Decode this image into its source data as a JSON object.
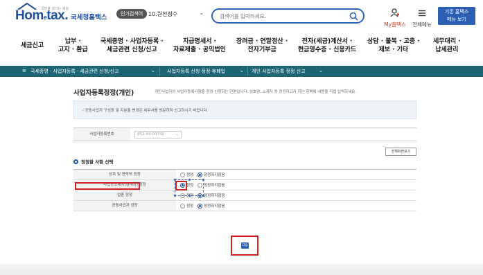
{
  "header": {
    "logo_text": "Hom",
    "logo_e": "e",
    "logo_text2": "tax.",
    "logo_tagline": "국민을 섬기는 세상",
    "logo_subtitle": "국세청홈택스",
    "popular_badge": "인기검색어",
    "popular_word": "10.원천징수",
    "search_placeholder": "검색어를 입력하세요.",
    "my_hometax": "My홈택스",
    "all_menu": "전체메뉴",
    "legacy_btn_line1": "기존 홈택스",
    "legacy_btn_line2": "메뉴 보기"
  },
  "gnb": [
    {
      "line1": "세금신고",
      "line2": ""
    },
    {
      "line1": "납부 ·",
      "line2": "고지 · 환급"
    },
    {
      "line1": "국세증명 · 사업자등록 ·",
      "line2": "세금관련 신청/신고"
    },
    {
      "line1": "지급명세서 ·",
      "line2": "자료제출 · 공익법인"
    },
    {
      "line1": "장려금 · 연말정산 ·",
      "line2": "전자기부금"
    },
    {
      "line1": "전자(세금)계산서 ·",
      "line2": "현금영수증 · 신용카드"
    },
    {
      "line1": "상담 · 불복 · 고충 ·",
      "line2": "제보 · 기타"
    },
    {
      "line1": "세무대리 ·",
      "line2": "납세관리"
    }
  ],
  "breadcrumb": {
    "menu_icon": "≡",
    "item1": "국세증명 · 사업자등록 · 세금관련 신청/신고",
    "item2": "사업자등록 신청·정정·휴폐업",
    "item3": "개인 사업자등록 정정 신고"
  },
  "content": {
    "title": "사업자등록정정(개인)",
    "description": "개인사업자의 사업자등록사항을 정정 신청하는 민원입니다. 상호명, 소재지 등 정정하고자 하는 항목에 내용을 직접 입력하세요.",
    "notice": "- 공동사업자 구성원 및 지분율 변경은 세무서를 방문하여 신고하시기 바랍니다.",
    "reg_no_label": "사업자등록번호",
    "reg_no_value": "852-44-00740",
    "view_all_button": "전체화면보기",
    "section_title": "정정할 사항 선택",
    "options": [
      {
        "label": "상호 및 연락처 정정",
        "yes": "정정",
        "no": "정정하지않음",
        "selected": "no"
      },
      {
        "label": "사업장소재지(임대차) 정정",
        "yes": "정정",
        "no": "정정하지않음",
        "selected": "yes"
      },
      {
        "label": "업종 정정",
        "yes": "정정",
        "no": "정정하지않음",
        "selected": "no"
      },
      {
        "label": "공동사업자 정정",
        "yes": "정정",
        "no": "정정하지않음",
        "selected": "no"
      }
    ],
    "next_button": "다음"
  },
  "colors": {
    "brand": "#1e4f9c",
    "breadcrumb_bg": "#1c6574",
    "highlight": "#d02020"
  }
}
